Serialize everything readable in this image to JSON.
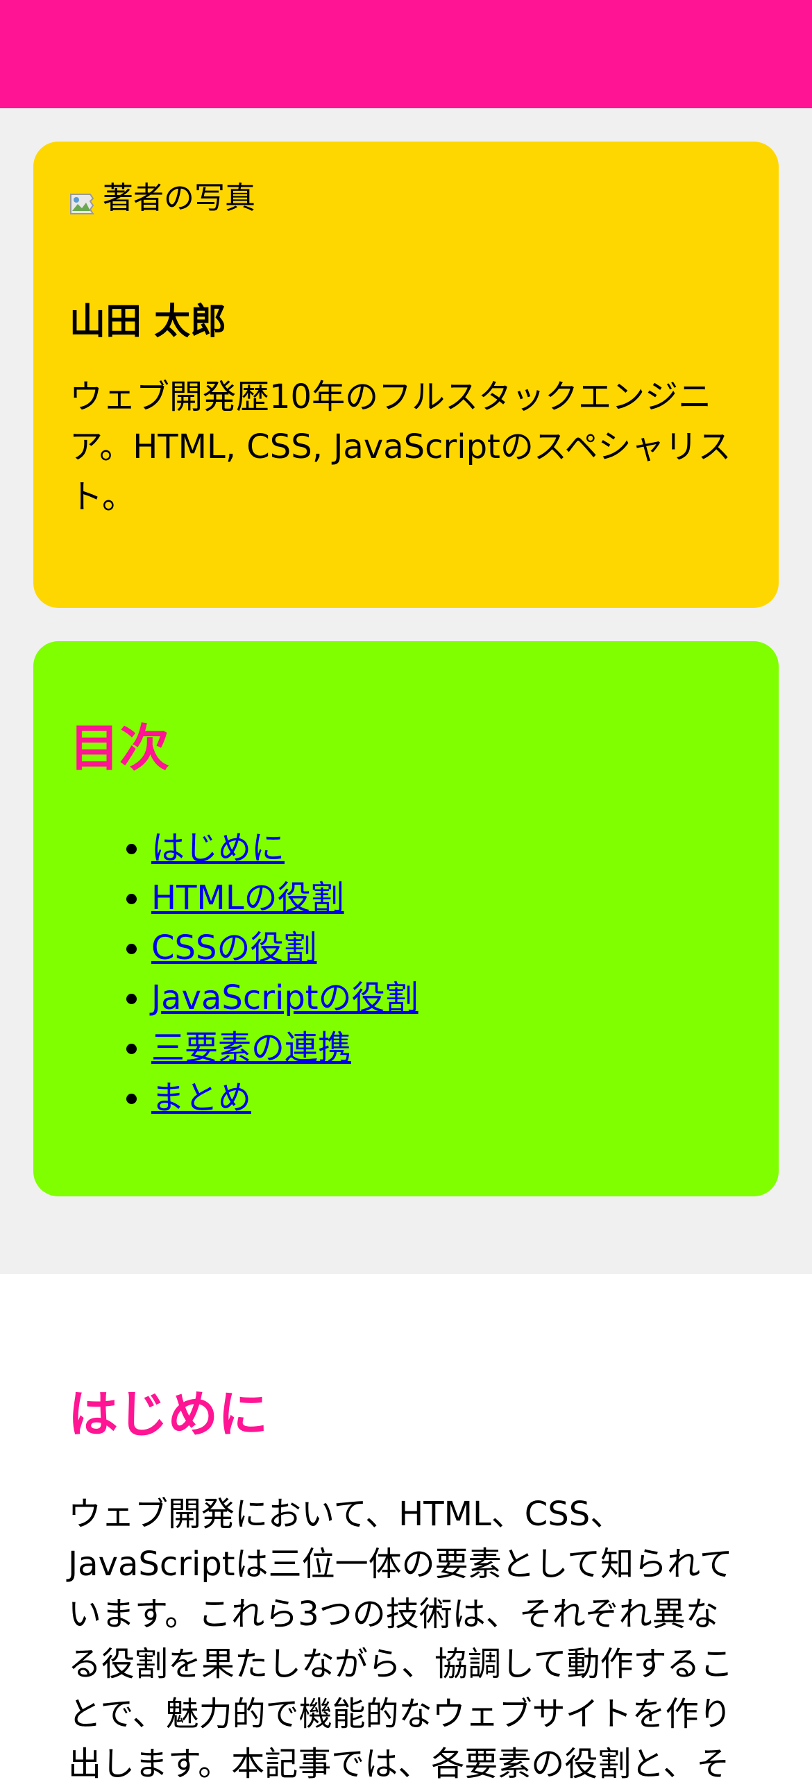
{
  "author": {
    "photo_alt": "著者の写真",
    "name": "山田 太郎",
    "bio": "ウェブ開発歴10年のフルスタックエンジニア。HTML, CSS, JavaScriptのスペシャリスト。"
  },
  "toc": {
    "title": "目次",
    "items": [
      {
        "label": "はじめに"
      },
      {
        "label": "HTMLの役割"
      },
      {
        "label": "CSSの役割"
      },
      {
        "label": "JavaScriptの役割"
      },
      {
        "label": "三要素の連携"
      },
      {
        "label": "まとめ"
      }
    ]
  },
  "article": {
    "intro_title": "はじめに",
    "intro_body": "ウェブ開発において、HTML、CSS、JavaScriptは三位一体の要素として知られています。これら3つの技術は、それぞれ異なる役割を果たしながら、協調して動作することで、魅力的で機能的なウェブサイトを作り出します。本記事では、各要素の役割と、そ"
  },
  "colors": {
    "header": "#ff1493",
    "author_card": "#ffd700",
    "toc_card": "#7fff00",
    "heading": "#ff1493",
    "link": "#0000ee"
  }
}
